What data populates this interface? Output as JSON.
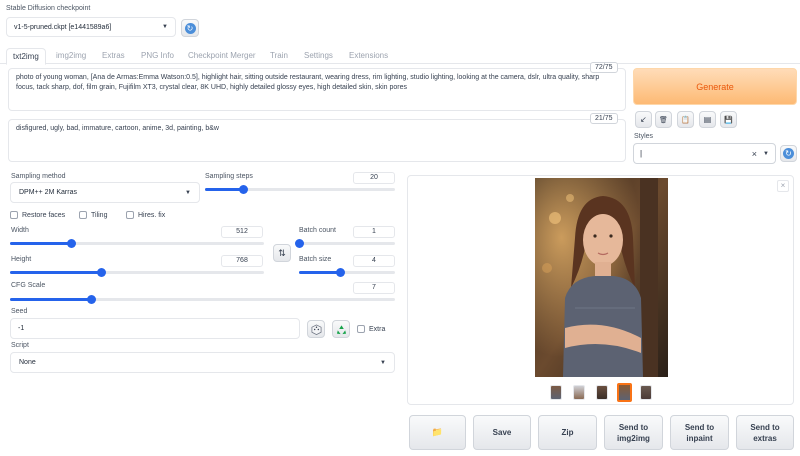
{
  "checkpoint": {
    "label": "Stable Diffusion checkpoint",
    "value": "v1-5-pruned.ckpt [e1441589a6]"
  },
  "tabs": [
    "txt2img",
    "img2img",
    "Extras",
    "PNG Info",
    "Checkpoint Merger",
    "Train",
    "Settings",
    "Extensions"
  ],
  "prompt": {
    "text": "photo of young woman, [Ana de Armas:Emma Watson:0.5], highlight hair, sitting outside restaurant, wearing dress, rim lighting, studio lighting, looking at the camera, dslr, ultra quality, sharp focus, tack sharp, dof, film grain, Fujifilm XT3, crystal clear, 8K UHD, highly detailed glossy eyes, high detailed skin, skin pores",
    "token_count": "72/75"
  },
  "negative_prompt": {
    "text": "disfigured, ugly, bad, immature, cartoon, anime, 3d, painting, b&w",
    "token_count": "21/75"
  },
  "generate_label": "Generate",
  "tool_buttons": {
    "arrow": "↙",
    "trash": "🗑",
    "clipboard": "📋",
    "page": "▤",
    "save": "💾"
  },
  "styles": {
    "label": "Styles",
    "clear": "×"
  },
  "sampling_method": {
    "label": "Sampling method",
    "value": "DPM++ 2M Karras"
  },
  "sampling_steps": {
    "label": "Sampling steps",
    "value": "20",
    "fraction": 0.2
  },
  "checkboxes": {
    "restore_faces": "Restore faces",
    "tiling": "Tiling",
    "hires_fix": "Hires. fix"
  },
  "width": {
    "label": "Width",
    "value": "512",
    "fraction": 0.24
  },
  "height": {
    "label": "Height",
    "value": "768",
    "fraction": 0.36
  },
  "swap_icon": "⇅",
  "batch_count": {
    "label": "Batch count",
    "value": "1",
    "fraction": 0.0
  },
  "batch_size": {
    "label": "Batch size",
    "value": "4",
    "fraction": 0.43
  },
  "cfg_scale": {
    "label": "CFG Scale",
    "value": "7",
    "fraction": 0.21
  },
  "seed": {
    "label": "Seed",
    "value": "-1",
    "extra_label": "Extra"
  },
  "script": {
    "label": "Script",
    "value": "None"
  },
  "gallery": {
    "close": "×"
  },
  "actions": {
    "folder": "📁",
    "save": "Save",
    "zip": "Zip",
    "send_img2img_1": "Send to",
    "send_img2img_2": "img2img",
    "send_inpaint_1": "Send to",
    "send_inpaint_2": "inpaint",
    "send_extras_1": "Send to",
    "send_extras_2": "extras"
  },
  "colors": {
    "accent": "#2563eb",
    "generate_bg": "#fdba74",
    "generate_text": "#ea580c",
    "refresh": "#4b8ed9"
  }
}
